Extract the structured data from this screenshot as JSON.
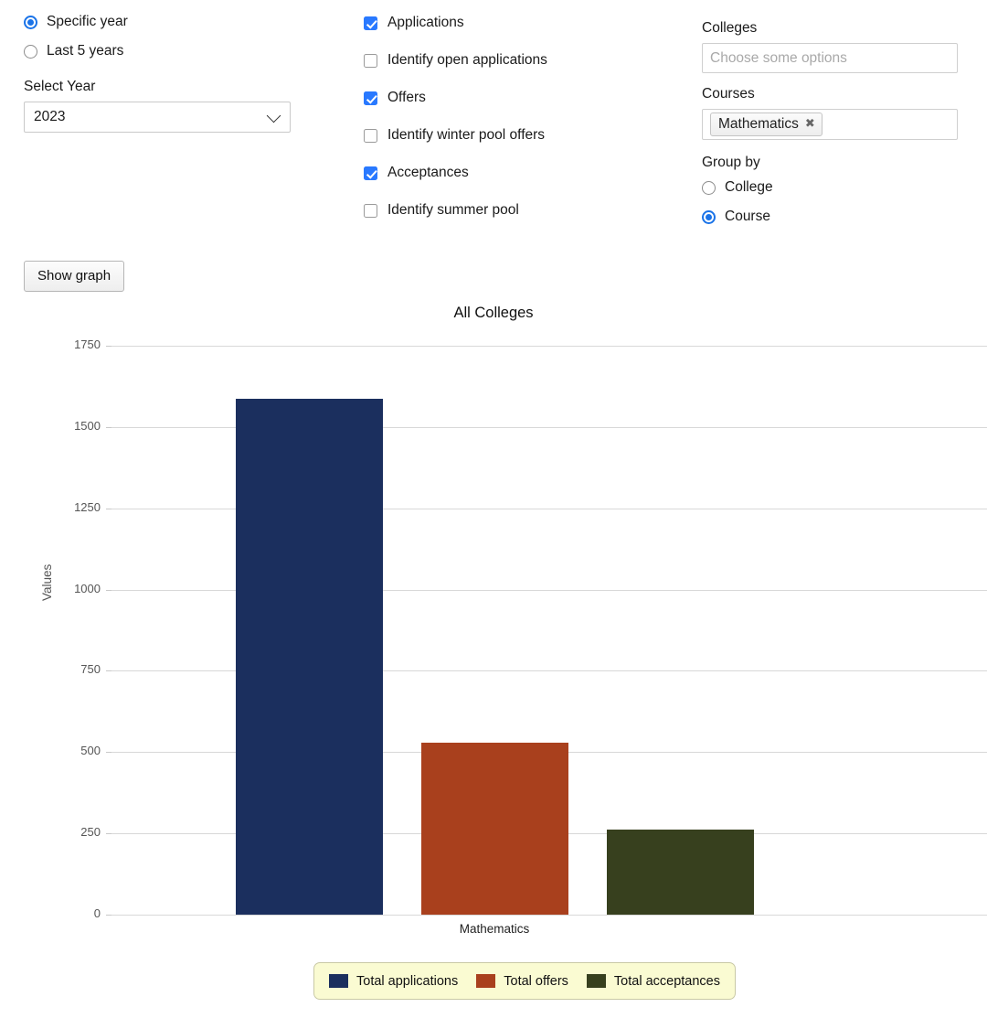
{
  "year_mode": {
    "options": [
      {
        "label": "Specific year",
        "selected": true
      },
      {
        "label": "Last 5 years",
        "selected": false
      }
    ]
  },
  "select_year": {
    "label": "Select Year",
    "value": "2023",
    "icon": "chevron-down-icon"
  },
  "metrics": [
    {
      "label": "Applications",
      "checked": true
    },
    {
      "label": "Identify open applications",
      "checked": false
    },
    {
      "label": "Offers",
      "checked": true
    },
    {
      "label": "Identify winter pool offers",
      "checked": false
    },
    {
      "label": "Acceptances",
      "checked": true
    },
    {
      "label": "Identify summer pool",
      "checked": false
    }
  ],
  "colleges": {
    "label": "Colleges",
    "placeholder": "Choose some options",
    "selected": []
  },
  "courses": {
    "label": "Courses",
    "selected": [
      {
        "label": "Mathematics",
        "remove_icon": "close-icon",
        "remove_glyph": "✖"
      }
    ]
  },
  "group_by": {
    "label": "Group by",
    "options": [
      {
        "label": "College",
        "selected": false
      },
      {
        "label": "Course",
        "selected": true
      }
    ]
  },
  "actions": {
    "show_graph": "Show graph"
  },
  "colors": {
    "applications": "#1b2f5e",
    "offers": "#a9401d",
    "acceptances": "#37401e",
    "accent_blue": "#1a73e8",
    "checkbox_blue": "#2979ff",
    "legend_background": "#fafbd2",
    "gridline": "#d8d8d8"
  },
  "chart_data": {
    "type": "bar",
    "title": "All Colleges",
    "xlabel": "",
    "ylabel": "Values",
    "categories": [
      "Mathematics"
    ],
    "series": [
      {
        "name": "Total applications",
        "values": [
          1588
        ],
        "color": "#1b2f5e"
      },
      {
        "name": "Total offers",
        "values": [
          528
        ],
        "color": "#a9401d"
      },
      {
        "name": "Total acceptances",
        "values": [
          261
        ],
        "color": "#37401e"
      }
    ],
    "ylim": [
      0,
      1750
    ],
    "yticks": [
      0,
      250,
      500,
      750,
      1000,
      1250,
      1500,
      1750
    ],
    "ytick_labels": [
      "0",
      "250",
      "500",
      "750",
      "1000",
      "1250",
      "1500",
      "1750"
    ],
    "grid": true,
    "legend_position": "bottom"
  }
}
